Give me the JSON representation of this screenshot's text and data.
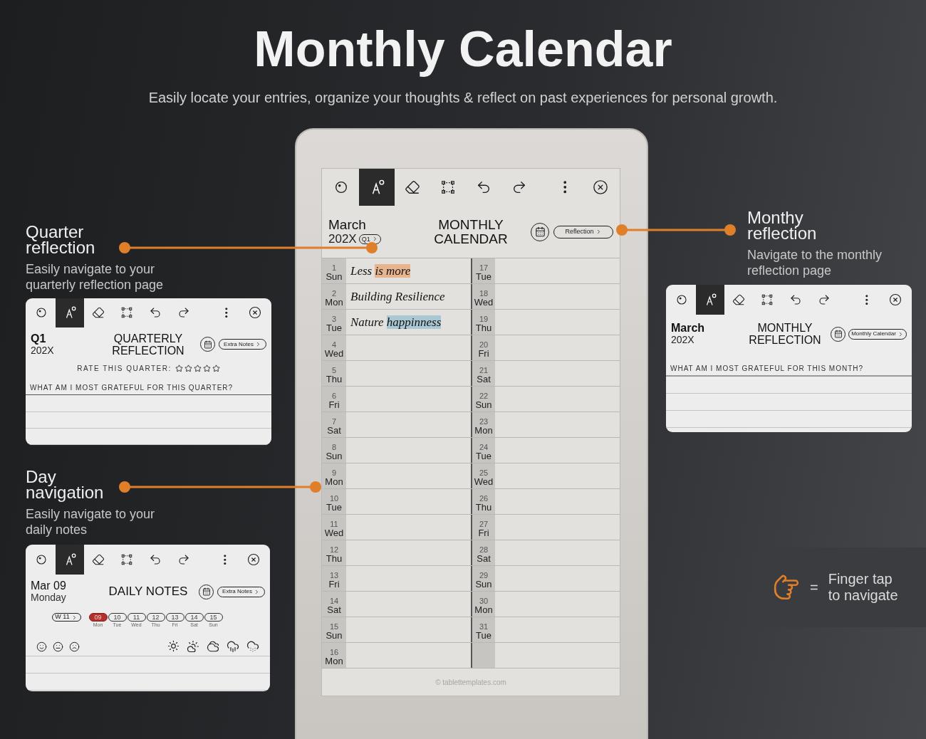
{
  "title": "Monthly Calendar",
  "subtitle": "Easily locate your entries, organize your thoughts & reflect on past experiences for personal growth.",
  "callouts": [
    {
      "title": "Quarter reflection",
      "description": "Easily navigate to your quarterly reflection page"
    },
    {
      "title": "Day navigation",
      "description": "Easily navigate to your daily notes"
    },
    {
      "title": "Monthy reflection",
      "description": "Navigate to the monthly reflection page"
    }
  ],
  "quarterly_card": {
    "tools": [
      {
        "kind": "lasso",
        "selected": false
      },
      {
        "kind": "pen",
        "selected": true
      },
      {
        "kind": "eraser",
        "selected": false
      },
      {
        "kind": "select",
        "selected": false
      },
      {
        "kind": "undo",
        "selected": false
      },
      {
        "kind": "redo",
        "selected": false
      },
      {
        "kind": "more",
        "selected": false
      },
      {
        "kind": "close",
        "selected": false
      }
    ],
    "period": "Q1",
    "year": "202X",
    "heading": "QUARTERLY REFLECTION",
    "link": "Extra Notes",
    "rating_label": "RATE THIS QUARTER:",
    "stars": 0,
    "question": "WHAT AM I MOST GRATEFUL FOR THIS QUARTER?"
  },
  "daily_card": {
    "tools": [
      {
        "kind": "lasso",
        "selected": false
      },
      {
        "kind": "pen",
        "selected": true
      },
      {
        "kind": "eraser",
        "selected": false
      },
      {
        "kind": "select",
        "selected": false
      },
      {
        "kind": "undo",
        "selected": false
      },
      {
        "kind": "redo",
        "selected": false
      },
      {
        "kind": "more",
        "selected": false
      },
      {
        "kind": "close",
        "selected": false
      }
    ],
    "date": "Mar 09",
    "weekday": "Monday",
    "heading": "DAILY NOTES",
    "link": "Extra Notes",
    "week": "W 11",
    "days": [
      {
        "number": "09",
        "day": "Mon",
        "selected": true
      },
      {
        "number": "10",
        "day": "Tue",
        "selected": false
      },
      {
        "number": "11",
        "day": "Wed",
        "selected": false
      },
      {
        "number": "12",
        "day": "Thu",
        "selected": false
      },
      {
        "number": "13",
        "day": "Fri",
        "selected": false
      },
      {
        "number": "14",
        "day": "Sat",
        "selected": false
      },
      {
        "number": "15",
        "day": "Sun",
        "selected": false
      }
    ],
    "moods": [
      {
        "kind": "happy"
      },
      {
        "kind": "neutral"
      },
      {
        "kind": "sad"
      }
    ],
    "weather": [
      {
        "kind": "sun"
      },
      {
        "kind": "partly_cloudy"
      },
      {
        "kind": "cloudy"
      },
      {
        "kind": "rain"
      },
      {
        "kind": "snow"
      }
    ]
  },
  "monthly_card": {
    "tools": [
      {
        "kind": "lasso",
        "selected": false
      },
      {
        "kind": "pen",
        "selected": true
      },
      {
        "kind": "eraser",
        "selected": false
      },
      {
        "kind": "select",
        "selected": false
      },
      {
        "kind": "undo",
        "selected": false
      },
      {
        "kind": "redo",
        "selected": false
      },
      {
        "kind": "more",
        "selected": false
      },
      {
        "kind": "close",
        "selected": false
      }
    ],
    "month": "March",
    "year": "202X",
    "heading": "MONTHLY REFLECTION",
    "link": "Monthly Calendar",
    "question": "WHAT AM I MOST GRATEFUL FOR THIS MONTH?"
  },
  "tablet": {
    "tools": [
      {
        "kind": "lasso",
        "selected": false
      },
      {
        "kind": "pen",
        "selected": true
      },
      {
        "kind": "eraser",
        "selected": false
      },
      {
        "kind": "select",
        "selected": false
      },
      {
        "kind": "undo",
        "selected": false
      },
      {
        "kind": "redo",
        "selected": false
      },
      {
        "kind": "more",
        "selected": false
      },
      {
        "kind": "close",
        "selected": false
      }
    ],
    "month": "March",
    "year": "202X",
    "quarter": "Q1",
    "heading": "MONTHLY CALENDAR",
    "link": "Reflection",
    "left_days": [
      {
        "number": "1",
        "day": "Sun",
        "entry": [
          {
            "text": "Less "
          },
          {
            "text": "is more",
            "color": "#e8b48e"
          }
        ]
      },
      {
        "number": "2",
        "day": "Mon",
        "entry": [
          {
            "text": "Building Resilience"
          }
        ]
      },
      {
        "number": "3",
        "day": "Tue",
        "entry": [
          {
            "text": "Nature "
          },
          {
            "text": "happinness",
            "color": "#a9c8d4"
          }
        ]
      },
      {
        "number": "4",
        "day": "Wed"
      },
      {
        "number": "5",
        "day": "Thu"
      },
      {
        "number": "6",
        "day": "Fri"
      },
      {
        "number": "7",
        "day": "Sat"
      },
      {
        "number": "8",
        "day": "Sun"
      },
      {
        "number": "9",
        "day": "Mon"
      },
      {
        "number": "10",
        "day": "Tue"
      },
      {
        "number": "11",
        "day": "Wed"
      },
      {
        "number": "12",
        "day": "Thu"
      },
      {
        "number": "13",
        "day": "Fri"
      },
      {
        "number": "14",
        "day": "Sat"
      },
      {
        "number": "15",
        "day": "Sun"
      },
      {
        "number": "16",
        "day": "Mon"
      }
    ],
    "right_days": [
      {
        "number": "17",
        "day": "Tue"
      },
      {
        "number": "18",
        "day": "Wed"
      },
      {
        "number": "19",
        "day": "Thu"
      },
      {
        "number": "20",
        "day": "Fri"
      },
      {
        "number": "21",
        "day": "Sat"
      },
      {
        "number": "22",
        "day": "Sun"
      },
      {
        "number": "23",
        "day": "Mon"
      },
      {
        "number": "24",
        "day": "Tue"
      },
      {
        "number": "25",
        "day": "Wed"
      },
      {
        "number": "26",
        "day": "Thu"
      },
      {
        "number": "27",
        "day": "Fri"
      },
      {
        "number": "28",
        "day": "Sat"
      },
      {
        "number": "29",
        "day": "Sun"
      },
      {
        "number": "30",
        "day": "Mon"
      },
      {
        "number": "31",
        "day": "Tue"
      }
    ],
    "footer": "© tablettemplates.com"
  },
  "hint": {
    "symbol": "=",
    "text": "Finger tap to navigate"
  }
}
